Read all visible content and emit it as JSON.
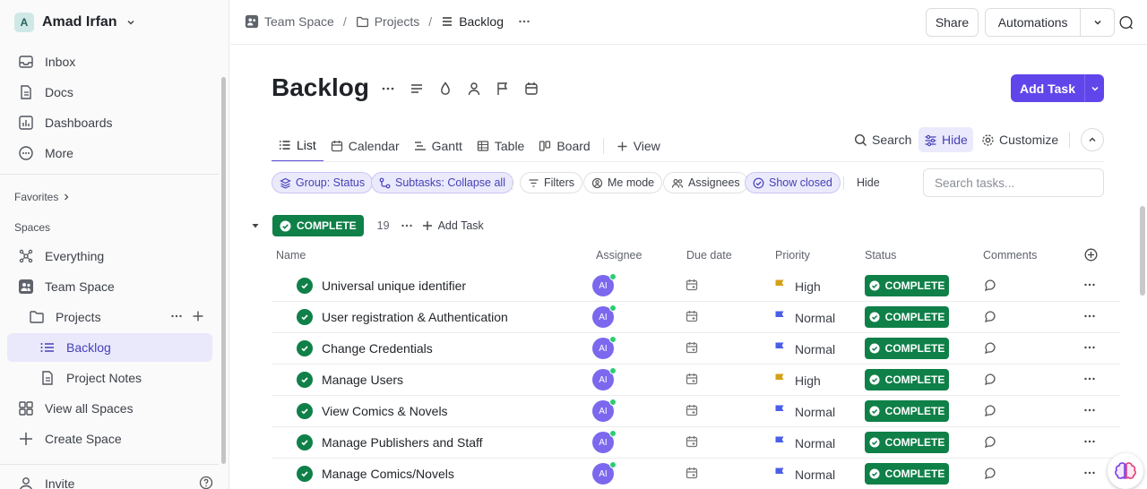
{
  "workspace": {
    "avatar_letter": "A",
    "name": "Amad Irfan"
  },
  "sidebar": {
    "nav": [
      {
        "label": "Inbox",
        "icon": "inbox-icon"
      },
      {
        "label": "Docs",
        "icon": "docs-icon"
      },
      {
        "label": "Dashboards",
        "icon": "dashboards-icon"
      },
      {
        "label": "More",
        "icon": "more-circle-icon"
      }
    ],
    "favorites_label": "Favorites",
    "spaces_label": "Spaces",
    "spaces": [
      {
        "label": "Everything",
        "icon": "everything-icon"
      },
      {
        "label": "Team Space",
        "icon": "team-icon"
      },
      {
        "label": "Projects",
        "icon": "folder-icon"
      },
      {
        "label": "Backlog",
        "icon": "list-icon"
      },
      {
        "label": "Project Notes",
        "icon": "doc-icon"
      },
      {
        "label": "View all Spaces",
        "icon": "grid-icon"
      },
      {
        "label": "Create Space",
        "icon": "plus-icon"
      }
    ],
    "invite_label": "Invite"
  },
  "breadcrumb": {
    "space": "Team Space",
    "folder": "Projects",
    "list": "Backlog"
  },
  "topbar": {
    "share": "Share",
    "automations": "Automations"
  },
  "page": {
    "title": "Backlog",
    "add_task": "Add Task"
  },
  "views": {
    "list": "List",
    "calendar": "Calendar",
    "gantt": "Gantt",
    "table": "Table",
    "board": "Board",
    "add_view": "View"
  },
  "view_tools": {
    "search": "Search",
    "hide": "Hide",
    "customize": "Customize"
  },
  "filters": {
    "group": "Group: Status",
    "subtasks": "Subtasks: Collapse all",
    "filters": "Filters",
    "me_mode": "Me mode",
    "assignees": "Assignees",
    "show_closed": "Show closed",
    "hide": "Hide",
    "search_placeholder": "Search tasks..."
  },
  "group": {
    "status": "COMPLETE",
    "count": "19",
    "add_task": "Add Task",
    "color": "#0f8048"
  },
  "columns": {
    "name": "Name",
    "assignee": "Assignee",
    "due_date": "Due date",
    "priority": "Priority",
    "status": "Status",
    "comments": "Comments"
  },
  "tasks": [
    {
      "name": "Universal unique identifier",
      "assignee": "AI",
      "priority": "High",
      "status": "COMPLETE"
    },
    {
      "name": "User registration & Authentication",
      "assignee": "AI",
      "priority": "Normal",
      "status": "COMPLETE"
    },
    {
      "name": "Change Credentials",
      "assignee": "AI",
      "priority": "Normal",
      "status": "COMPLETE"
    },
    {
      "name": "Manage Users",
      "assignee": "AI",
      "priority": "High",
      "status": "COMPLETE"
    },
    {
      "name": "View Comics & Novels",
      "assignee": "AI",
      "priority": "Normal",
      "status": "COMPLETE"
    },
    {
      "name": "Manage Publishers and Staff",
      "assignee": "AI",
      "priority": "Normal",
      "status": "COMPLETE"
    },
    {
      "name": "Manage Comics/Novels",
      "assignee": "AI",
      "priority": "Normal",
      "status": "COMPLETE"
    }
  ],
  "colors": {
    "accent": "#6046ea",
    "complete": "#0f8048",
    "flag_high": "#d4a017",
    "flag_normal": "#4a5ee8"
  }
}
